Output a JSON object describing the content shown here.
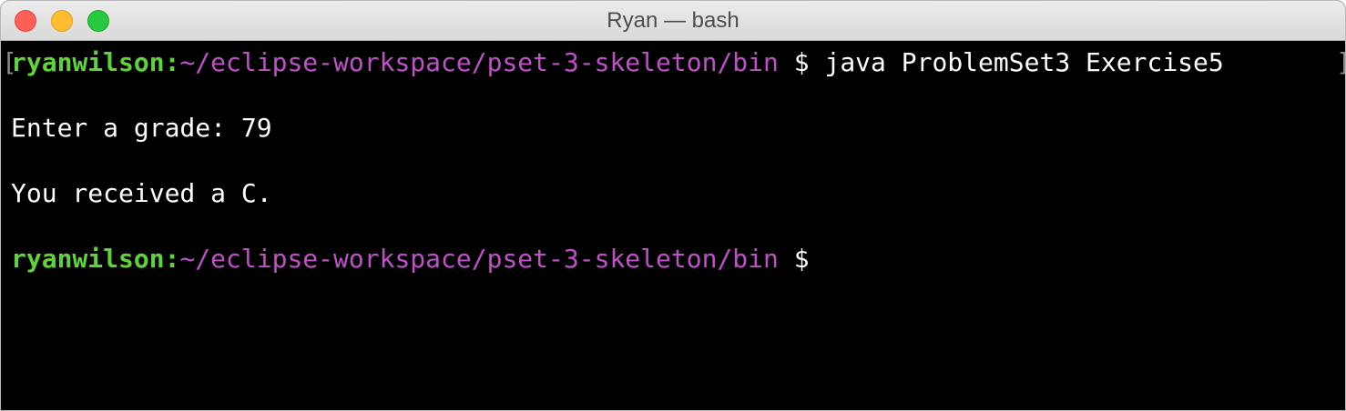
{
  "window": {
    "title": "Ryan — bash"
  },
  "colors": {
    "user": "#5fd43a",
    "path": "#c050c8",
    "text": "#ffffff",
    "background": "#000000"
  },
  "terminal": {
    "lines": [
      {
        "user": "ryanwilson:",
        "path": "~/eclipse-workspace/pset-3-skeleton/bin",
        "rest": " $ java ProblemSet3 Exercise5"
      },
      {
        "text": "Enter a grade: 79"
      },
      {
        "text": "You received a C."
      },
      {
        "user": "ryanwilson:",
        "path": "~/eclipse-workspace/pset-3-skeleton/bin",
        "rest": " $"
      }
    ]
  }
}
